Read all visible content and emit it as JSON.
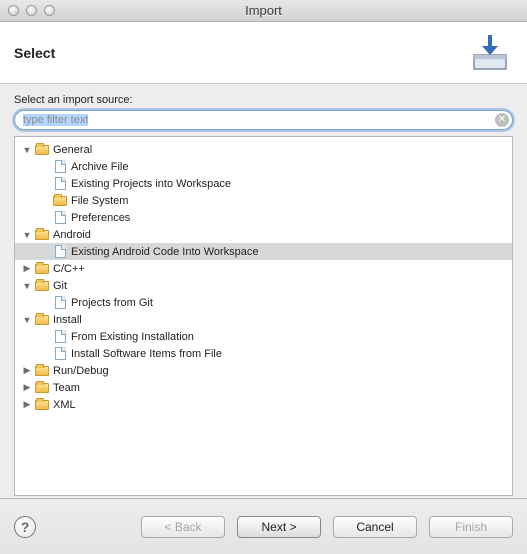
{
  "window": {
    "title": "Import"
  },
  "banner": {
    "heading": "Select"
  },
  "prompt": "Select an import source:",
  "filter": {
    "placeholder": "type filter text",
    "value": "type filter text"
  },
  "tree": [
    {
      "id": "general",
      "depth": 0,
      "expand": "open",
      "icon": "folder",
      "label": "General"
    },
    {
      "id": "archive-file",
      "depth": 1,
      "expand": "none",
      "icon": "file",
      "label": "Archive File"
    },
    {
      "id": "existing-projects",
      "depth": 1,
      "expand": "none",
      "icon": "file",
      "label": "Existing Projects into Workspace"
    },
    {
      "id": "file-system",
      "depth": 1,
      "expand": "none",
      "icon": "folder",
      "label": "File System"
    },
    {
      "id": "preferences",
      "depth": 1,
      "expand": "none",
      "icon": "file",
      "label": "Preferences"
    },
    {
      "id": "android",
      "depth": 0,
      "expand": "open",
      "icon": "folder",
      "label": "Android"
    },
    {
      "id": "existing-android-code",
      "depth": 1,
      "expand": "none",
      "icon": "file",
      "label": "Existing Android Code Into Workspace",
      "selected": true
    },
    {
      "id": "ccpp",
      "depth": 0,
      "expand": "closed",
      "icon": "folder",
      "label": "C/C++"
    },
    {
      "id": "git",
      "depth": 0,
      "expand": "open",
      "icon": "folder",
      "label": "Git"
    },
    {
      "id": "projects-from-git",
      "depth": 1,
      "expand": "none",
      "icon": "file",
      "label": "Projects from Git"
    },
    {
      "id": "install",
      "depth": 0,
      "expand": "open",
      "icon": "folder",
      "label": "Install"
    },
    {
      "id": "from-existing-installation",
      "depth": 1,
      "expand": "none",
      "icon": "file",
      "label": "From Existing Installation"
    },
    {
      "id": "install-software-items",
      "depth": 1,
      "expand": "none",
      "icon": "file",
      "label": "Install Software Items from File"
    },
    {
      "id": "run-debug",
      "depth": 0,
      "expand": "closed",
      "icon": "folder",
      "label": "Run/Debug"
    },
    {
      "id": "team",
      "depth": 0,
      "expand": "closed",
      "icon": "folder",
      "label": "Team"
    },
    {
      "id": "xml",
      "depth": 0,
      "expand": "closed",
      "icon": "folder",
      "label": "XML"
    }
  ],
  "buttons": {
    "back": "< Back",
    "next": "Next >",
    "cancel": "Cancel",
    "finish": "Finish"
  }
}
